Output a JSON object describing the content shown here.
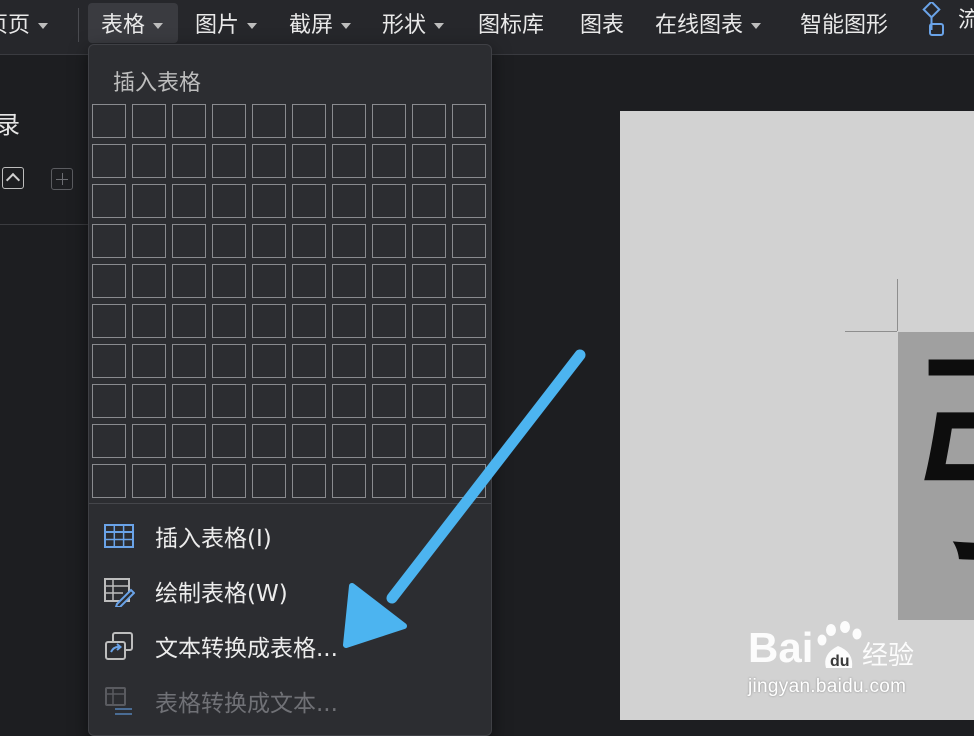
{
  "toolbar": {
    "items": [
      {
        "label": "页页",
        "has_caret": true
      },
      {
        "label": "表格",
        "has_caret": true
      },
      {
        "label": "图片",
        "has_caret": true
      },
      {
        "label": "截屏",
        "has_caret": true
      },
      {
        "label": "形状",
        "has_caret": true
      },
      {
        "label": "图标库",
        "has_caret": false
      },
      {
        "label": "图表",
        "has_caret": false
      },
      {
        "label": "在线图表",
        "has_caret": true
      },
      {
        "label": "智能图形",
        "has_caret": false
      },
      {
        "label": "流",
        "icon": "flowchart-icon"
      }
    ]
  },
  "left_panel": {
    "title": "录",
    "up_icon": "chevron-up-icon",
    "add_icon": "plus-icon"
  },
  "table_menu": {
    "header": "插入表格",
    "grid": {
      "rows": 10,
      "cols": 10
    },
    "items": [
      {
        "label": "插入表格(I)",
        "icon": "table-grid-icon",
        "enabled": true
      },
      {
        "label": "绘制表格(W)",
        "icon": "draw-table-icon",
        "enabled": true
      },
      {
        "label": "文本转换成表格...",
        "icon": "text-to-table-icon",
        "enabled": true
      },
      {
        "label": "表格转换成文本...",
        "icon": "table-to-text-icon",
        "enabled": false
      }
    ]
  },
  "document": {
    "glyph": "引"
  },
  "watermark": {
    "brand": "Bai 经验",
    "url": "jingyan.baidu.com"
  },
  "colors": {
    "toolbar_bg": "#26272b",
    "menu_bg": "#2c2d31",
    "page_bg": "#d2d2d2",
    "arrow": "#4cb4f0",
    "icon_blue": "#6aa3e8"
  }
}
